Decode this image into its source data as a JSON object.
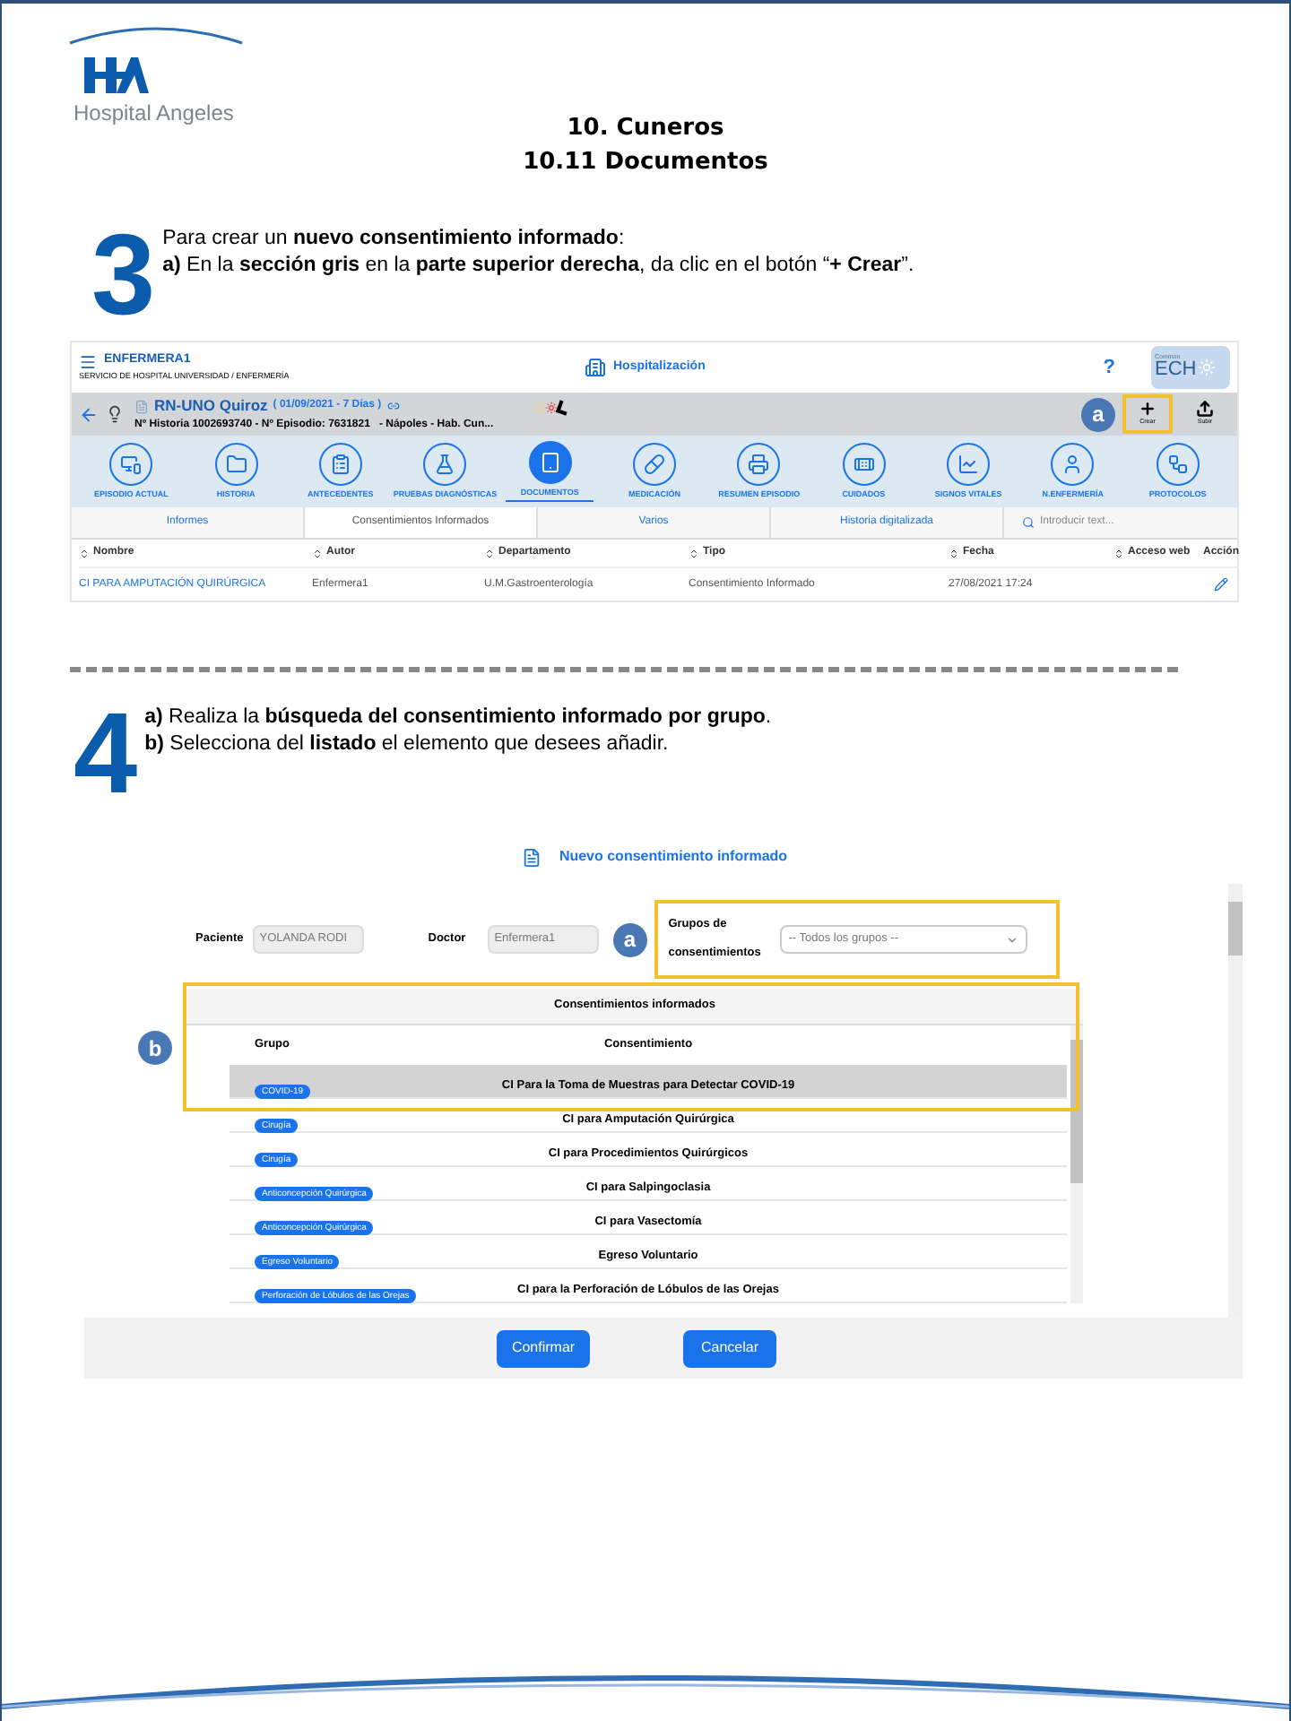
{
  "header": {
    "logo_text": "Hospital Angeles",
    "title": "10. Cuneros",
    "subtitle": "10.11 Documentos"
  },
  "step3": {
    "number": "3",
    "lines": [
      "Para crear un **nuevo consentimiento informado**:",
      "**a)** En la **sección gris** en la **parte superior derecha**, da clic en el botón “**+ Crear**”."
    ]
  },
  "screen1": {
    "user": "ENFERMERA1",
    "service": "SERVICIO DE HOSPITAL UNIVERSIDAD / ENFERMERÍA",
    "module": "Hospitalización",
    "help": "?",
    "brand_small": "Common",
    "brand": "ECH",
    "patient_name": "RN-UNO Quiroz",
    "patient_dates": "( 01/09/2021 - 7 Días )",
    "patient_info": "Nº Historia 1002693740 - Nº Episodio: 7631821   - Nápoles - Hab. Cun...",
    "callout": "a",
    "actions": [
      {
        "label": "Crear",
        "kind": "plus",
        "highlighted": true
      },
      {
        "label": "Subir",
        "kind": "upload",
        "highlighted": false
      }
    ],
    "nav": [
      {
        "label": "EPISODIO ACTUAL",
        "kind": "episode",
        "selected": false
      },
      {
        "label": "HISTORIA",
        "kind": "folder",
        "selected": false
      },
      {
        "label": "ANTECEDENTES",
        "kind": "clipboard",
        "selected": false
      },
      {
        "label": "PRUEBAS DIAGNÓSTICAS",
        "kind": "test",
        "selected": false
      },
      {
        "label": "DOCUMENTOS",
        "kind": "document",
        "selected": true
      },
      {
        "label": "MEDICACIÓN",
        "kind": "pill",
        "selected": false
      },
      {
        "label": "RESUMEN EPISODIO",
        "kind": "summary",
        "selected": false
      },
      {
        "label": "CUIDADOS",
        "kind": "bandage",
        "selected": false
      },
      {
        "label": "SIGNOS VITALES",
        "kind": "chart",
        "selected": false
      },
      {
        "label": "N.ENFERMERÍA",
        "kind": "nurse",
        "selected": false
      },
      {
        "label": "PROTOCOLOS",
        "kind": "flow",
        "selected": false
      }
    ],
    "tabs": [
      {
        "label": "Informes",
        "selected": false
      },
      {
        "label": "Consentimientos Informados",
        "selected": true
      },
      {
        "label": "Varios",
        "selected": false
      },
      {
        "label": "Historia digitalizada",
        "selected": false
      }
    ],
    "search": {
      "placeholder": "Introducir text..."
    },
    "columns": [
      {
        "label": "Nombre",
        "sortable": true
      },
      {
        "label": "Autor",
        "sortable": true
      },
      {
        "label": "Departamento",
        "sortable": true
      },
      {
        "label": "Tipo",
        "sortable": true
      },
      {
        "label": "Fecha",
        "sortable": true
      },
      {
        "label": "Acceso web",
        "sortable": true
      },
      {
        "label": "Acción",
        "sortable": false
      }
    ],
    "rows": [
      {
        "name": "CI PARA AMPUTACIÓN QUIRÚRGICA",
        "author": "Enfermera1",
        "department": "U.M.Gastroenterología",
        "type": "Consentimiento Informado",
        "date": "27/08/2021 17:24"
      }
    ]
  },
  "step4": {
    "number": "4",
    "lines": [
      "**a)** Realiza la **búsqueda del consentimiento informado por grupo**.",
      "**b)** Selecciona del **listado** el elemento que desees añadir."
    ]
  },
  "dialog": {
    "title": "Nuevo consentimiento informado",
    "patient_label": "Paciente",
    "patient_value": "YOLANDA RODI",
    "doctor_label": "Doctor",
    "doctor_value": "Enfermera1",
    "callout_a": "a",
    "group_label": "Grupos de consentimientos",
    "group_select": "-- Todos los grupos --",
    "list_title": "Consentimientos informados",
    "callout_b": "b",
    "columns": [
      "Grupo",
      "Consentimiento"
    ],
    "rows": [
      {
        "group": "COVID-19",
        "consent": "CI Para la Toma de Muestras para Detectar COVID-19",
        "selected": true
      },
      {
        "group": "Cirugía",
        "consent": "CI para Amputación Quirúrgica",
        "selected": false
      },
      {
        "group": "Cirugía",
        "consent": "CI para Procedimientos Quirúrgicos",
        "selected": false
      },
      {
        "group": "Anticoncepción Quirúrgica",
        "consent": "CI para Salpingoclasia",
        "selected": false
      },
      {
        "group": "Anticoncepción Quirúrgica",
        "consent": "CI para Vasectomía",
        "selected": false
      },
      {
        "group": "Egreso Voluntario",
        "consent": "Egreso Voluntario",
        "selected": false
      },
      {
        "group": "Perforación de Lóbulos de las Orejas",
        "consent": "CI para la Perforación de Lóbulos de las Orejas",
        "selected": false
      }
    ],
    "buttons": [
      "Confirmar",
      "Cancelar"
    ]
  }
}
